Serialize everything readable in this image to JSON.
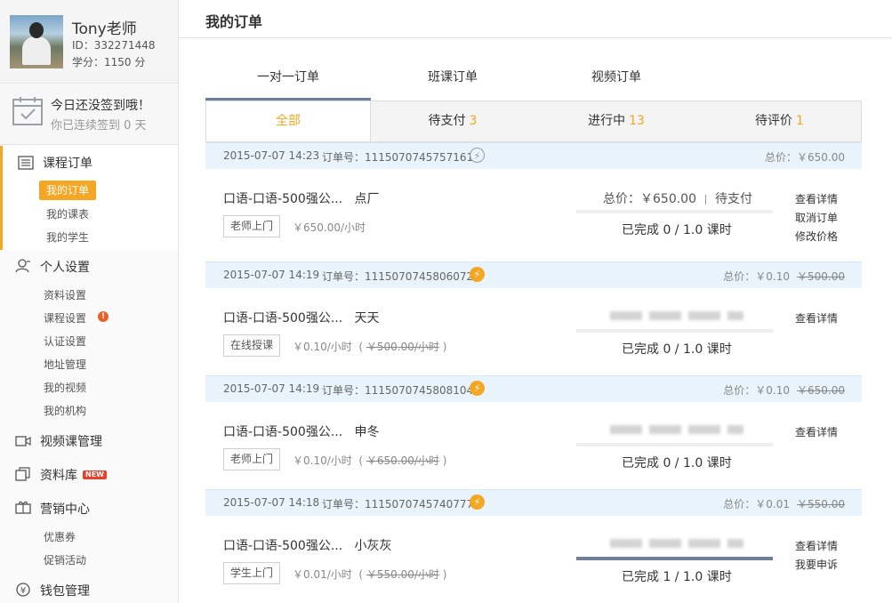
{
  "profile": {
    "name": "Tony老师",
    "id_text": "ID：332271448",
    "score_text": "学分：1150 分"
  },
  "checkin": {
    "title": "今日还没签到哦！",
    "subtitle": "你已连续签到 0 天"
  },
  "nav": {
    "course_orders": {
      "label": "课程订单",
      "items": [
        "我的订单",
        "我的课表",
        "我的学生"
      ]
    },
    "settings": {
      "label": "个人设置",
      "items": [
        "资料设置",
        "课程设置",
        "认证设置",
        "地址管理",
        "我的视频",
        "我的机构"
      ],
      "warning": "!"
    },
    "video": {
      "label": "视频课管理"
    },
    "library": {
      "label": "资料库",
      "badge": "NEW"
    },
    "marketing": {
      "label": "营销中心",
      "items": [
        "优惠券",
        "促销活动"
      ]
    },
    "wallet": {
      "label": "钱包管理"
    }
  },
  "page_title": "我的订单",
  "tabs_main": [
    "一对一订单",
    "班课订单",
    "视频订单"
  ],
  "tabs_status": [
    {
      "label": "全部",
      "count": ""
    },
    {
      "label": "待支付",
      "count": "3"
    },
    {
      "label": "进行中",
      "count": "13"
    },
    {
      "label": "待评价",
      "count": "1"
    }
  ],
  "orders": [
    {
      "date": "2015-07-07 14:23",
      "order_no": "订单号：1115070745757161",
      "total": "总价：￥650.00",
      "total_orig": "",
      "name": "口语-口语-500强公...",
      "student": "点厂",
      "tag": "老师上门",
      "price": "￥650.00/小时",
      "price_orig": "",
      "status_total": "总价：￥650.00",
      "status_text": "待支付",
      "progress": 0,
      "done": "已完成 0 / 1.0 课时",
      "actions": [
        "查看详情",
        "取消订单",
        "修改价格"
      ]
    },
    {
      "date": "2015-07-07 14:19",
      "order_no": "订单号：1115070745806072",
      "total": "总价：￥0.10",
      "total_orig": "￥500.00",
      "name": "口语-口语-500强公...",
      "student": "天天",
      "tag": "在线授课",
      "price": "￥0.10/小时",
      "price_orig": "￥500.00/小时",
      "progress": 0,
      "done": "已完成 0 / 1.0 课时",
      "actions": [
        "查看详情"
      ]
    },
    {
      "date": "2015-07-07 14:19",
      "order_no": "订单号：1115070745808104",
      "total": "总价：￥0.10",
      "total_orig": "￥650.00",
      "name": "口语-口语-500强公...",
      "student": "申冬",
      "tag": "老师上门",
      "price": "￥0.10/小时",
      "price_orig": "￥650.00/小时",
      "progress": 0,
      "done": "已完成 0 / 1.0 课时",
      "actions": [
        "查看详情"
      ]
    },
    {
      "date": "2015-07-07 14:18",
      "order_no": "订单号：1115070745740777",
      "total": "总价：￥0.01",
      "total_orig": "￥550.00",
      "name": "口语-口语-500强公...",
      "student": "小灰灰",
      "tag": "学生上门",
      "price": "￥0.01/小时",
      "price_orig": "￥550.00/小时",
      "progress": 1,
      "done": "已完成 1 / 1.0 课时",
      "actions": [
        "查看详情",
        "我要申诉"
      ]
    }
  ],
  "colors": {
    "accent": "#f5a623",
    "tab_indicator": "#6e7f9a",
    "order_header_bg": "#e8f3fb"
  }
}
